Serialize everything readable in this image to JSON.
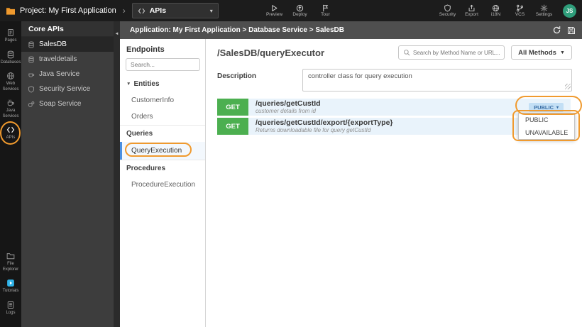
{
  "glyphs": {
    "chevron": "›",
    "caret_down": "▾",
    "collapse_left": "◄",
    "tree_caret": "▼"
  },
  "topbar": {
    "project_label": "Project: My First Application",
    "module_dropdown": {
      "label": "APIs"
    },
    "center_actions": [
      {
        "label": "Preview"
      },
      {
        "label": "Deploy"
      },
      {
        "label": "Tour"
      }
    ],
    "right_actions": [
      {
        "label": "Security"
      },
      {
        "label": "Export"
      },
      {
        "label": "i18N"
      },
      {
        "label": "VCS"
      },
      {
        "label": "Settings"
      }
    ],
    "avatar_initials": "JS"
  },
  "iconbar": {
    "top": [
      {
        "label": "Pages"
      },
      {
        "label": "Databases"
      },
      {
        "label": "Web Services"
      },
      {
        "label": "Java Services"
      },
      {
        "label": "APIs"
      }
    ],
    "bottom": [
      {
        "label": "File Explorer"
      },
      {
        "label": "Tutorials"
      },
      {
        "label": "Logs"
      }
    ]
  },
  "services_panel": {
    "title": "Core APIs",
    "items": [
      {
        "label": "SalesDB"
      },
      {
        "label": "traveldetails"
      },
      {
        "label": "Java Service"
      },
      {
        "label": "Security Service"
      },
      {
        "label": "Soap Service"
      }
    ]
  },
  "breadcrumb": {
    "text": "Application: My First Application > Database Service > SalesDB"
  },
  "endpoints_panel": {
    "title": "Endpoints",
    "search_placeholder": "Search...",
    "groups": {
      "entities": "Entities",
      "queries": "Queries",
      "procedures": "Procedures"
    },
    "entities_items": [
      "CustomerInfo",
      "Orders"
    ],
    "queries_items": [
      "QueryExecution"
    ],
    "procedures_items": [
      "ProcedureExecution"
    ]
  },
  "main": {
    "title": "/SalesDB/queryExecutor",
    "search_placeholder": "Search by Method Name or URL...",
    "methods_filter_label": "All Methods",
    "description_label": "Description",
    "description_value": "controller class for query execution",
    "endpoints": [
      {
        "method": "GET",
        "path": "/queries/getCustId",
        "summary": "customer details from id",
        "access": "PUBLIC"
      },
      {
        "method": "GET",
        "path": "/queries/getCustId/export/{exportType}",
        "summary": "Returns downloadable file for query getCustId"
      }
    ],
    "access_menu_options": [
      "PUBLIC",
      "UNAVAILABLE"
    ]
  },
  "colors": {
    "method_get": "#4caf50",
    "annotation": "#f09a2e",
    "endpoint_row_bg": "#e9f3fb",
    "access_pill_bg": "#c3dff5",
    "avatar_bg": "#2f9e7b"
  }
}
